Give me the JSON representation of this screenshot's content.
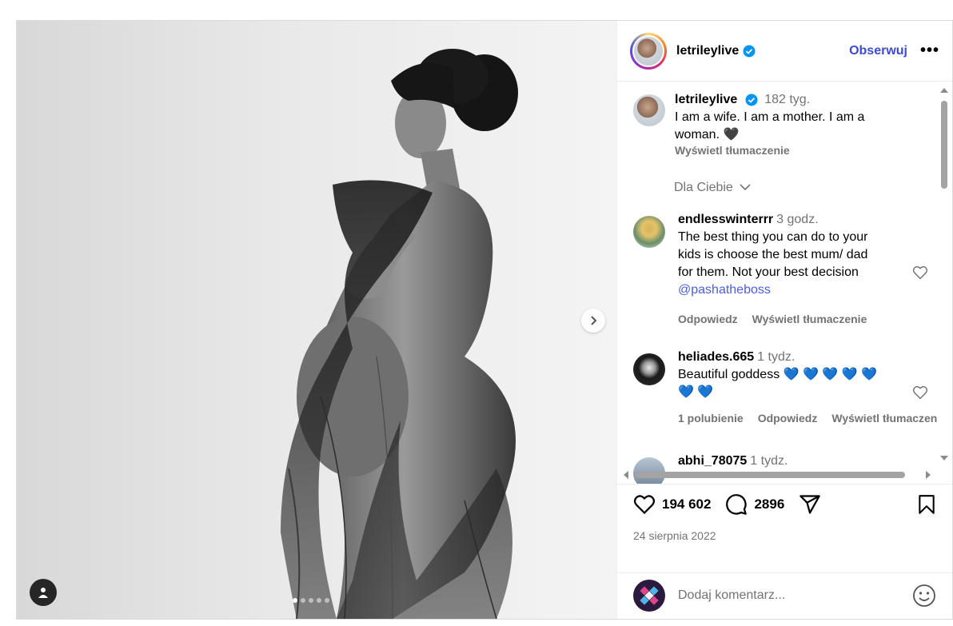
{
  "post": {
    "username": "letrileylive",
    "follow_label": "Obserwuj",
    "more_label": "•••"
  },
  "caption": {
    "username": "letrileylive",
    "time": "182 tyg.",
    "text_line1": "I am a wife. I am a mother. I am a",
    "text_line2": "woman. 🖤",
    "translate_label": "Wyświetl tłumaczenie"
  },
  "filter": {
    "label": "Dla Ciebie"
  },
  "comments": [
    {
      "username": "endlesswinterrr",
      "time": "3 godz.",
      "lines": [
        "The best thing you can do to your",
        "kids is choose the best mum/ dad",
        "for them. Not your best decision"
      ],
      "mention": "@pashatheboss",
      "reply_label": "Odpowiedz",
      "translate_label": "Wyświetl tłumaczenie"
    },
    {
      "username": "heliades.665",
      "time": "1 tydz.",
      "line1": "Beautiful goddess 💙 💙 💙 💙 💙",
      "line2": "💙 💙",
      "likes_label": "1 polubienie",
      "reply_label": "Odpowiedz",
      "translate_label": "Wyświetl tłumaczen"
    },
    {
      "username": "abhi_78075",
      "time": "1 tydz."
    }
  ],
  "stats": {
    "likes": "194 602",
    "comments": "2896",
    "date": "24 sierpnia 2022"
  },
  "add_comment": {
    "placeholder": "Dodaj komentarz..."
  },
  "carousel": {
    "total": 5,
    "active": 0
  },
  "colors": {
    "link": "#4a5de4",
    "follow": "#3b4bd8",
    "muted": "#737373"
  }
}
